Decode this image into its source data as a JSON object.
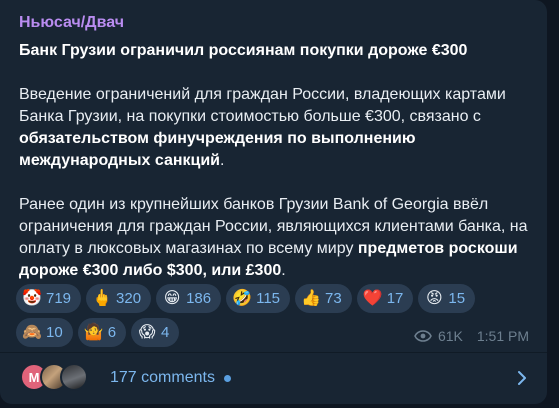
{
  "post": {
    "channel_name": "Ньюсач/Двач",
    "headline": "Банк Грузии ограничил россиянам покупки дороже €300",
    "paragraph1": {
      "plain": "Введение ограничений для граждан России, владеющих картами Банка Грузии, на покупки стоимостью больше €300, связано с ",
      "bold": "обязательством финучреждения по выполнению международных санкций",
      "end": "."
    },
    "paragraph2": {
      "plain": "Ранее один из крупнейших банков Грузии Bank of Georgia ввёл ограничения для граждан России, являющихся клиентами банка, на оплату в люксовых магазинах по всему миру ",
      "bold": "предметов роскоши дороже €300 либо $300, или £300",
      "end": "."
    }
  },
  "reactions": [
    {
      "emoji": "🤡",
      "count": "719"
    },
    {
      "emoji": "🖕",
      "count": "320"
    },
    {
      "emoji": "😁",
      "count": "186"
    },
    {
      "emoji": "🤣",
      "count": "115"
    },
    {
      "emoji": "👍",
      "count": "73"
    },
    {
      "emoji": "❤️",
      "count": "17"
    },
    {
      "emoji": "😡",
      "count": "15"
    },
    {
      "emoji": "🙈",
      "count": "10"
    },
    {
      "emoji": "🤷",
      "count": "6"
    },
    {
      "emoji": "😱",
      "count": "4"
    }
  ],
  "meta": {
    "views": "61K",
    "time": "1:51 PM",
    "views_icon": "eye-icon"
  },
  "comments": {
    "label": "177 comments",
    "first_avatar_letter": "M",
    "chevron_icon": "chevron-right-icon"
  },
  "colors": {
    "background": "#0e1621",
    "bubble": "#182533",
    "channel_name": "#b98cf0",
    "accent": "#7cb7ee",
    "reaction_bg": "#2b3d52",
    "meta": "#6d7f8f"
  }
}
